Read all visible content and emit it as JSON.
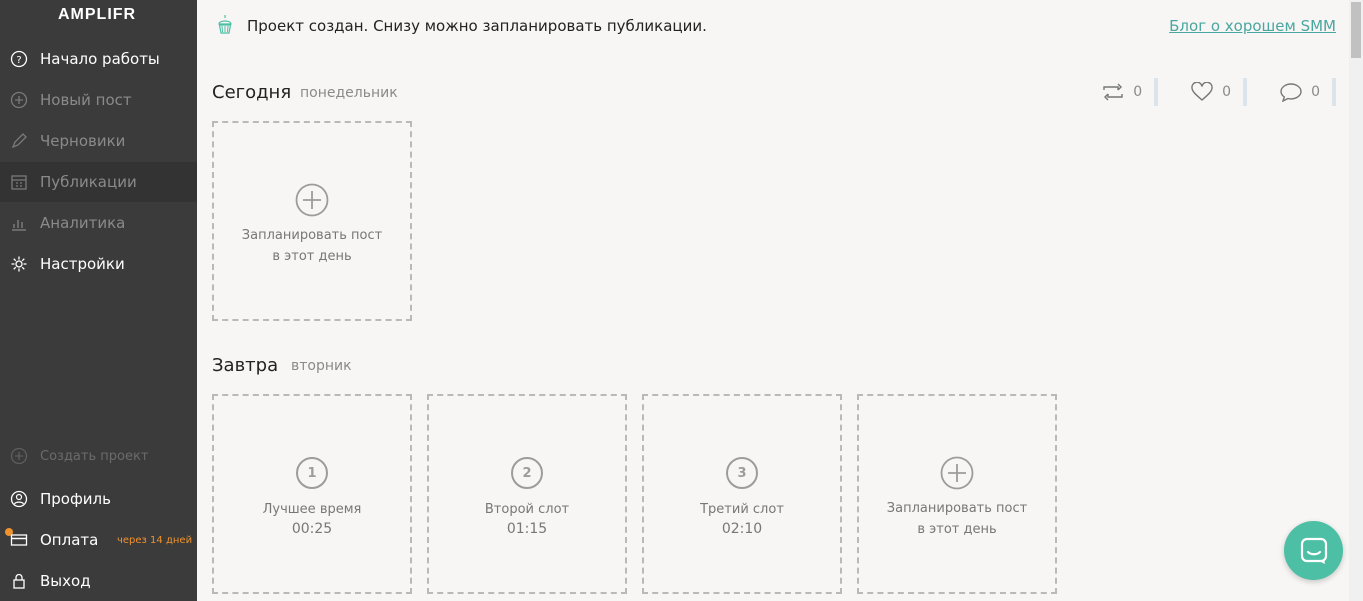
{
  "brand": {
    "logo": "AMPLIFR"
  },
  "sidebar": {
    "items": [
      {
        "label": "Начало работы",
        "icon": "question-circle-icon"
      },
      {
        "label": "Новый пост",
        "icon": "plus-circle-icon"
      },
      {
        "label": "Черновики",
        "icon": "pencil-icon"
      },
      {
        "label": "Публикации",
        "icon": "calendar-icon"
      },
      {
        "label": "Аналитика",
        "icon": "bar-chart-icon"
      },
      {
        "label": "Настройки",
        "icon": "gear-icon"
      }
    ],
    "create_project": "Создать проект",
    "profile": "Профиль",
    "billing": "Оплата",
    "billing_badge": "через 14 дней",
    "logout": "Выход"
  },
  "banner": {
    "text": "Проект создан. Снизу можно запланировать публикации.",
    "link": "Блог о хорошем SMM",
    "icon": "cupcake-icon"
  },
  "today": {
    "title": "Сегодня",
    "weekday": "понедельник",
    "stats": {
      "reposts": "0",
      "likes": "0",
      "comments": "0"
    },
    "slot": {
      "line1": "Запланировать пост",
      "line2": "в этот день"
    }
  },
  "tomorrow": {
    "title": "Завтра",
    "weekday": "вторник",
    "slots": [
      {
        "num": "1",
        "name": "Лучшее время",
        "time": "00:25"
      },
      {
        "num": "2",
        "name": "Второй слот",
        "time": "01:15"
      },
      {
        "num": "3",
        "name": "Третий слот",
        "time": "02:10"
      }
    ],
    "add_slot": {
      "line1": "Запланировать пост",
      "line2": "в этот день"
    }
  },
  "colors": {
    "sidebar": "#3b3b3b",
    "accent": "#4aa6a0",
    "chat": "#4dbfa4",
    "badge": "#f0922b"
  }
}
